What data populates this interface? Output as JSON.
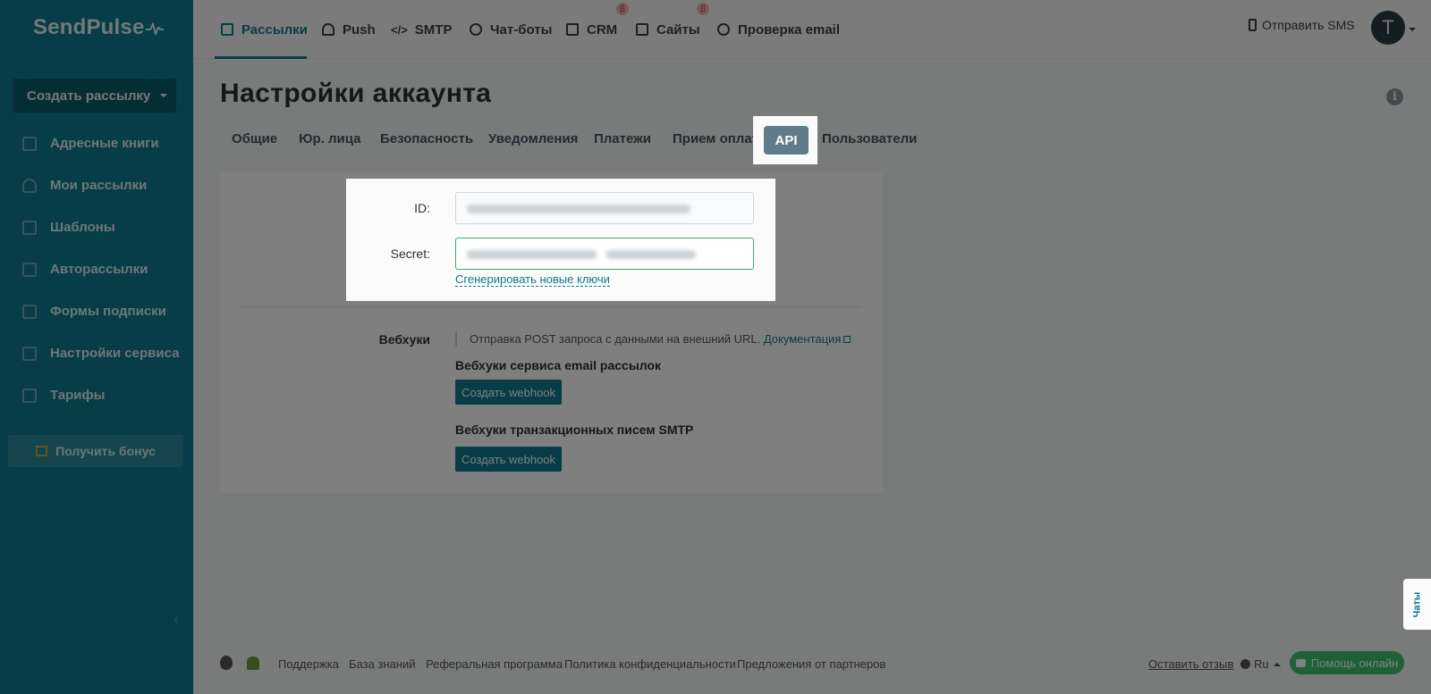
{
  "sidebar": {
    "logo": "SendPulse",
    "create_button": "Создать рассылку",
    "items": [
      {
        "label": "Адресные книги",
        "icon": "address-book-icon"
      },
      {
        "label": "Мои рассылки",
        "icon": "campaigns-icon"
      },
      {
        "label": "Шаблоны",
        "icon": "templates-icon"
      },
      {
        "label": "Авторассылки",
        "icon": "automation-icon"
      },
      {
        "label": "Формы подписки",
        "icon": "subscription-forms-icon"
      },
      {
        "label": "Настройки сервиса",
        "icon": "service-settings-icon"
      },
      {
        "label": "Тарифы",
        "icon": "pricing-icon"
      }
    ],
    "bonus_button": "Получить бонус"
  },
  "topnav": {
    "items": [
      {
        "label": "Рассылки",
        "active": true
      },
      {
        "label": "Push"
      },
      {
        "label": "SMTP"
      },
      {
        "label": "Чат-боты"
      },
      {
        "label": "CRM",
        "badge": "β"
      },
      {
        "label": "Сайты",
        "badge": "β"
      },
      {
        "label": "Проверка email"
      }
    ],
    "send_sms": "Отправить SMS",
    "avatar_letter": "T"
  },
  "page": {
    "title": "Настройки аккаунта",
    "tabs": [
      "Общие",
      "Юр. лица",
      "Безопасность",
      "Уведомления",
      "Платежи",
      "Прием оплат",
      "API",
      "Пользователи"
    ],
    "active_tab": "API"
  },
  "api": {
    "id_label": "ID:",
    "secret_label": "Secret:",
    "regenerate_link": "Сгенерировать новые ключи"
  },
  "webhooks": {
    "label": "Вебхуки",
    "description": "Отправка POST запроса с данными на внешний URL.",
    "docs_link": "Документация",
    "email_title": "Вебхуки сервиса email рассылок",
    "smtp_title": "Вебхуки транзакционных писем SMTP",
    "create_button": "Создать webhook"
  },
  "footer": {
    "links": [
      "Поддержка",
      "База знаний",
      "Реферальная программа",
      "Политика конфиденциальности",
      "Предложения от партнеров"
    ],
    "review": "Оставить отзыв",
    "language": "Ru",
    "help": "Помощь онлайн"
  },
  "chats_tab": "Чаты",
  "colors": {
    "brand": "#0c7a8d",
    "focus_green": "#2db36b",
    "help_green": "#3ac46f"
  }
}
